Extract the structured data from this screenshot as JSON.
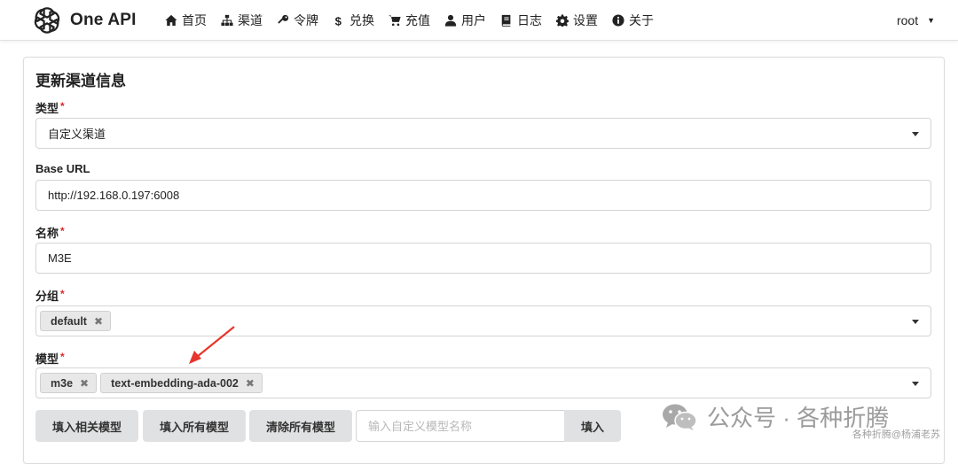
{
  "brand": {
    "name": "One API",
    "logo_icon": "openai-logo-icon"
  },
  "nav": {
    "items": [
      {
        "label": "首页",
        "icon": "home-icon"
      },
      {
        "label": "渠道",
        "icon": "sitemap-icon"
      },
      {
        "label": "令牌",
        "icon": "key-icon"
      },
      {
        "label": "兑换",
        "icon": "dollar-icon"
      },
      {
        "label": "充值",
        "icon": "cart-icon"
      },
      {
        "label": "用户",
        "icon": "user-icon"
      },
      {
        "label": "日志",
        "icon": "book-icon"
      },
      {
        "label": "设置",
        "icon": "gear-icon"
      },
      {
        "label": "关于",
        "icon": "info-icon"
      }
    ],
    "user": "root"
  },
  "form": {
    "title": "更新渠道信息",
    "type": {
      "label": "类型",
      "required": "*",
      "value": "自定义渠道"
    },
    "base_url": {
      "label": "Base URL",
      "value": "http://192.168.0.197:6008"
    },
    "name": {
      "label": "名称",
      "required": "*",
      "value": "M3E"
    },
    "group": {
      "label": "分组",
      "required": "*",
      "tags": [
        "default"
      ]
    },
    "models": {
      "label": "模型",
      "required": "*",
      "tags": [
        "m3e",
        "text-embedding-ada-002"
      ]
    },
    "buttons": {
      "fill_related": "填入相关模型",
      "fill_all": "填入所有模型",
      "clear_all": "清除所有模型",
      "custom_placeholder": "输入自定义模型名称",
      "fill": "填入"
    }
  },
  "annotation": {
    "arrow_color": "#e8352b"
  },
  "watermark": {
    "text": "公众号 · 各种折腾",
    "sub": "各种折腾@杨浦老苏"
  }
}
